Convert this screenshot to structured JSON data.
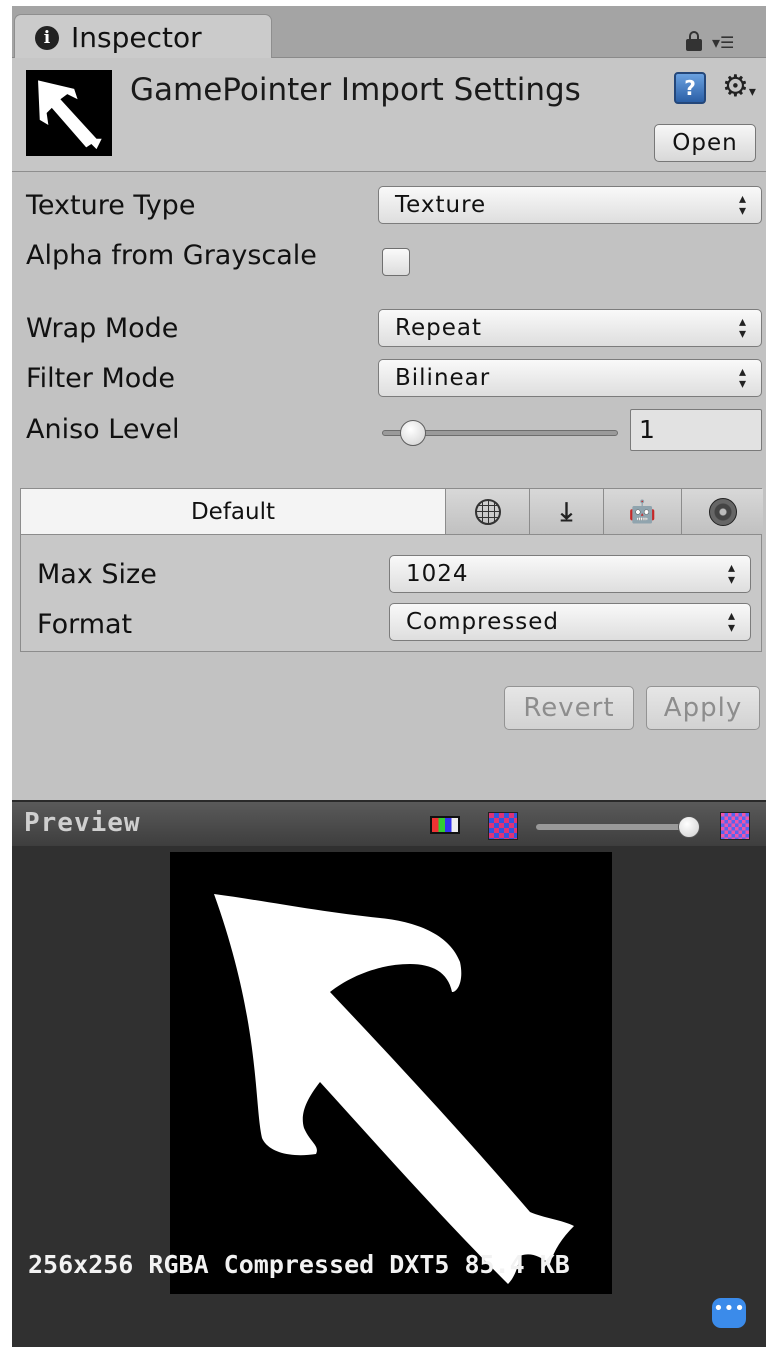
{
  "tab": {
    "title": "Inspector",
    "info_icon": "i"
  },
  "header": {
    "title": "GamePointer Import Settings",
    "open_label": "Open",
    "help_icon": "?"
  },
  "properties": {
    "texture_type": {
      "label": "Texture Type",
      "value": "Texture"
    },
    "alpha_from_grayscale": {
      "label": "Alpha from Grayscale",
      "checked": false
    },
    "wrap_mode": {
      "label": "Wrap Mode",
      "value": "Repeat"
    },
    "filter_mode": {
      "label": "Filter Mode",
      "value": "Bilinear"
    },
    "aniso_level": {
      "label": "Aniso Level",
      "value": "1"
    }
  },
  "platform_tabs": [
    "Default",
    "web-icon",
    "download-icon",
    "android-icon",
    "disc-icon"
  ],
  "platform": {
    "max_size": {
      "label": "Max Size",
      "value": "1024"
    },
    "format": {
      "label": "Format",
      "value": "Compressed"
    }
  },
  "buttons": {
    "revert": "Revert",
    "apply": "Apply"
  },
  "preview": {
    "title": "Preview",
    "info": "256x256  RGBA Compressed DXT5  85.4 KB"
  },
  "colors": {
    "panel": "#c2c2c2",
    "preview_bg": "#303030",
    "accent": "#3b8bea"
  }
}
